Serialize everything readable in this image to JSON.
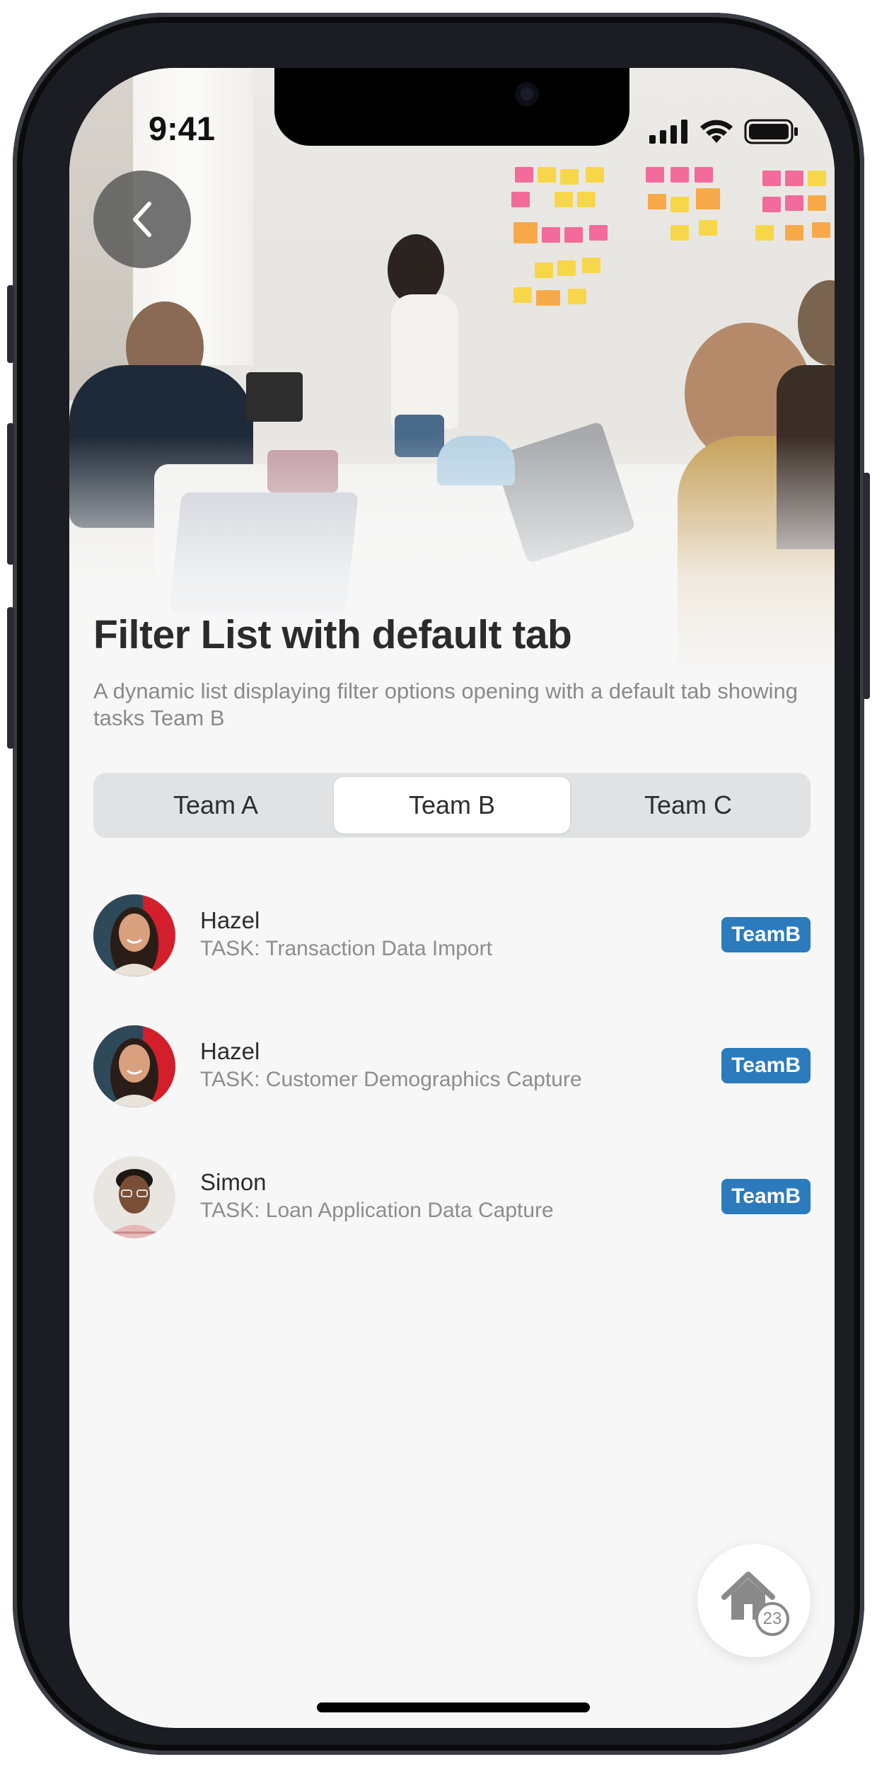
{
  "status_bar": {
    "time": "9:41"
  },
  "header": {
    "title": "Filter List with default tab",
    "subtitle": "A dynamic list displaying filter options opening with a default tab showing tasks Team B"
  },
  "tabs": [
    {
      "label": "Team A",
      "active": false
    },
    {
      "label": "Team B",
      "active": true
    },
    {
      "label": "Team C",
      "active": false
    }
  ],
  "list": [
    {
      "name": "Hazel",
      "task": "TASK: Transaction Data Import",
      "badge": "TeamB"
    },
    {
      "name": "Hazel",
      "task": "TASK: Customer Demographics Capture",
      "badge": "TeamB"
    },
    {
      "name": "Simon",
      "task": "TASK: Loan Application Data Capture",
      "badge": "TeamB"
    }
  ],
  "fab": {
    "icon": "home-icon",
    "count": "23"
  },
  "colors": {
    "badge": "#2b7bbd",
    "active_tab": "#ffffff",
    "tab_track": "#e1e2e4",
    "background": "#f7f7f7"
  }
}
